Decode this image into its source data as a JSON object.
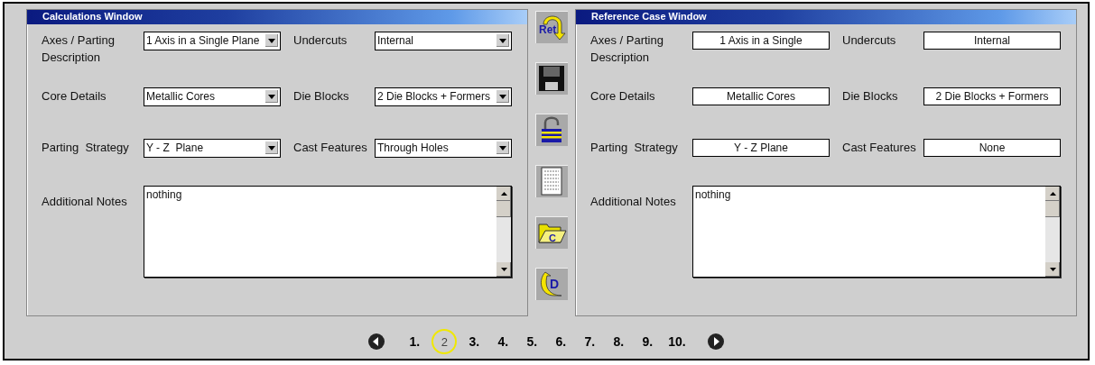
{
  "panels": [
    {
      "title": "Calculations Window",
      "kind": "editable",
      "fields": [
        {
          "label": "Axes / Parting Description",
          "value": "1 Axis in a Single Plane"
        },
        {
          "label": "Undercuts",
          "value": "Internal"
        },
        {
          "label": "Core Details",
          "value": "Metallic Cores"
        },
        {
          "label": "Die Blocks",
          "value": "2 Die Blocks + Formers"
        },
        {
          "label": "Parting  Strategy",
          "value": "Y - Z  Plane"
        },
        {
          "label": "Cast Features",
          "value": "Through Holes"
        }
      ],
      "notes": {
        "label": "Additional Notes",
        "value": "nothing"
      }
    },
    {
      "title": "Reference Case Window",
      "kind": "reference",
      "fields": [
        {
          "label": "Axes / Parting Description",
          "value": "1 Axis in a Single"
        },
        {
          "label": "Undercuts",
          "value": "Internal"
        },
        {
          "label": "Core Details",
          "value": "Metallic Cores"
        },
        {
          "label": "Die Blocks",
          "value": "2 Die Blocks + Formers"
        },
        {
          "label": "Parting  Strategy",
          "value": "Y - Z  Plane"
        },
        {
          "label": "Cast Features",
          "value": "None"
        }
      ],
      "notes": {
        "label": "Additional Notes",
        "value": "nothing"
      }
    }
  ],
  "toolbar": [
    {
      "kind": "return",
      "label": "Ret"
    },
    {
      "kind": "save"
    },
    {
      "kind": "unlock"
    },
    {
      "kind": "document"
    },
    {
      "kind": "folder",
      "label": "C"
    },
    {
      "kind": "rotate",
      "label": "D"
    }
  ],
  "pager": [
    {
      "label": "1.",
      "selected": false
    },
    {
      "label": "2",
      "selected": true
    },
    {
      "label": "3.",
      "selected": false
    },
    {
      "label": "4.",
      "selected": false
    },
    {
      "label": "5.",
      "selected": false
    },
    {
      "label": "6.",
      "selected": false
    },
    {
      "label": "7.",
      "selected": false
    },
    {
      "label": "8.",
      "selected": false
    },
    {
      "label": "9.",
      "selected": false
    },
    {
      "label": "10.",
      "selected": false
    }
  ]
}
